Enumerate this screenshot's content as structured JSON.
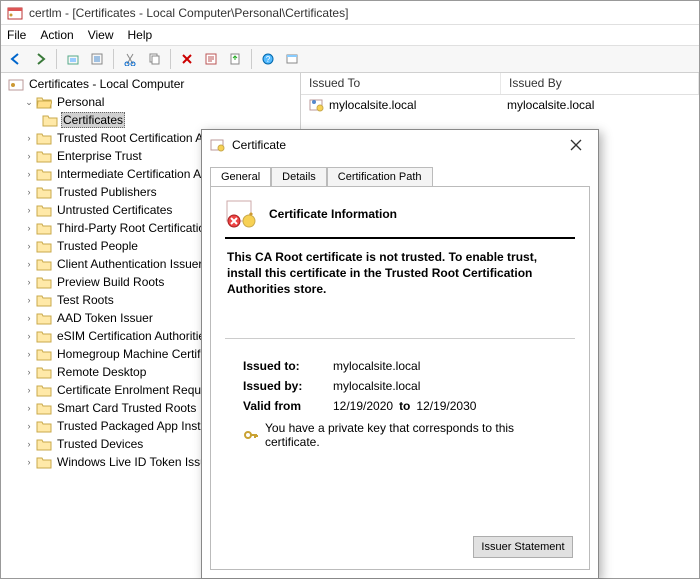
{
  "window": {
    "title": "certlm - [Certificates - Local Computer\\Personal\\Certificates]"
  },
  "menu": {
    "file": "File",
    "action": "Action",
    "view": "View",
    "help": "Help"
  },
  "tree": {
    "root": "Certificates - Local Computer",
    "personal": "Personal",
    "personal_certs": "Certificates",
    "items": [
      "Trusted Root Certification Au",
      "Enterprise Trust",
      "Intermediate Certification Au",
      "Trusted Publishers",
      "Untrusted Certificates",
      "Third-Party Root Certification",
      "Trusted People",
      "Client Authentication Issuers",
      "Preview Build Roots",
      "Test Roots",
      "AAD Token Issuer",
      "eSIM Certification Authorities",
      "Homegroup Machine Certifi",
      "Remote Desktop",
      "Certificate Enrolment Reque",
      "Smart Card Trusted Roots",
      "Trusted Packaged App Instal",
      "Trusted Devices",
      "Windows Live ID Token Issue"
    ]
  },
  "list": {
    "col1": "Issued To",
    "col2": "Issued By",
    "row": {
      "to": "mylocalsite.local",
      "by": "mylocalsite.local"
    }
  },
  "dialog": {
    "title": "Certificate",
    "tabs": {
      "general": "General",
      "details": "Details",
      "certpath": "Certification Path"
    },
    "heading": "Certificate Information",
    "warning": "This CA Root certificate is not trusted. To enable trust, install this certificate in the Trusted Root Certification Authorities store.",
    "issued_to_label": "Issued to:",
    "issued_to": "mylocalsite.local",
    "issued_by_label": "Issued by:",
    "issued_by": "mylocalsite.local",
    "valid_from_label": "Valid from",
    "valid_from": "12/19/2020",
    "valid_to_label": "to",
    "valid_to": "12/19/2030",
    "pk_note": "You have a private key that corresponds to this certificate.",
    "issuer_btn": "Issuer Statement"
  }
}
